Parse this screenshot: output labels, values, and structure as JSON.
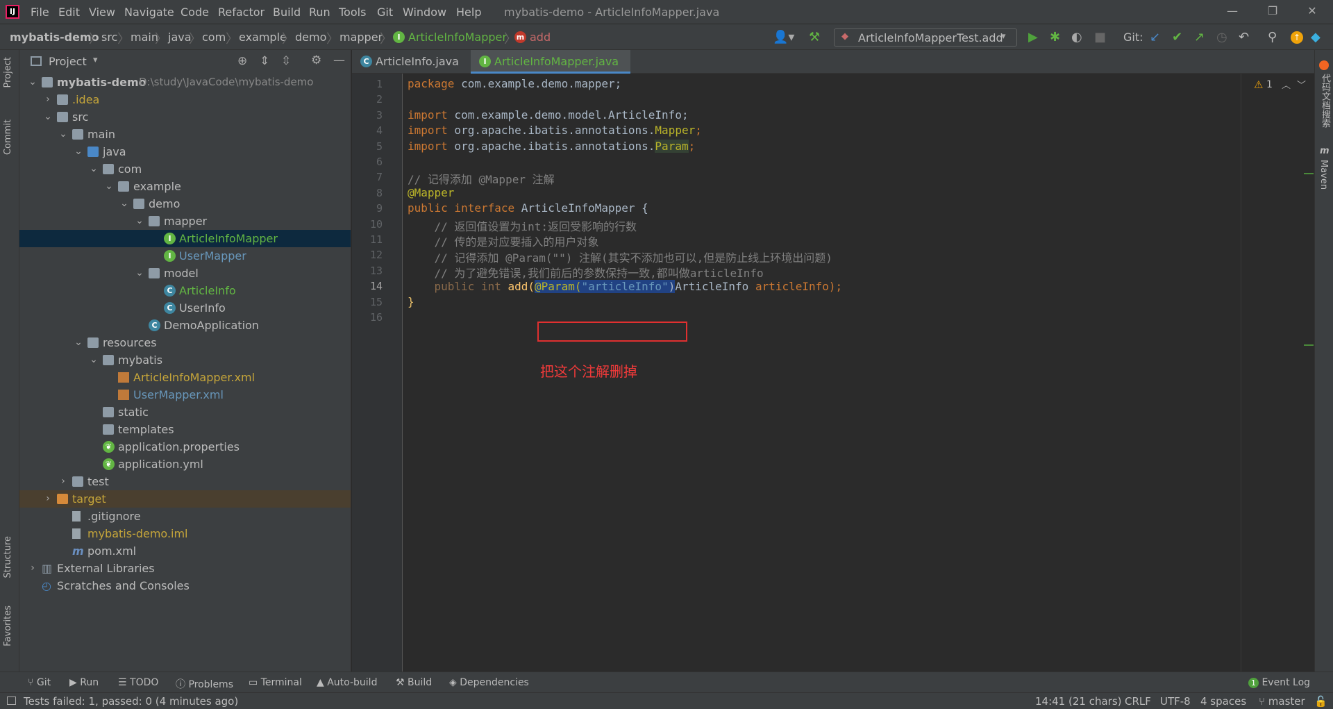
{
  "menu": [
    "File",
    "Edit",
    "View",
    "Navigate",
    "Code",
    "Refactor",
    "Build",
    "Run",
    "Tools",
    "Git",
    "Window",
    "Help"
  ],
  "window_title": "mybatis-demo - ArticleInfoMapper.java",
  "breadcrumbs": [
    "mybatis-demo",
    "src",
    "main",
    "java",
    "com",
    "example",
    "demo",
    "mapper",
    "ArticleInfoMapper",
    "add"
  ],
  "run_config": "ArticleInfoMapperTest.add",
  "git_label": "Git:",
  "project_panel": {
    "title": "Project",
    "tree": [
      {
        "label": "mybatis-demo",
        "extra": "D:\\study\\JavaCode\\mybatis-demo",
        "depth": 0,
        "arrow": "down",
        "icon": "folder",
        "color": "#bbbbbb",
        "bold": true
      },
      {
        "label": ".idea",
        "depth": 1,
        "arrow": "right",
        "icon": "folder",
        "color": "#c5a53a"
      },
      {
        "label": "src",
        "depth": 1,
        "arrow": "down",
        "icon": "folder",
        "color": "#bbbbbb"
      },
      {
        "label": "main",
        "depth": 2,
        "arrow": "down",
        "icon": "folder",
        "color": "#bbbbbb"
      },
      {
        "label": "java",
        "depth": 3,
        "arrow": "down",
        "icon": "folder-blue",
        "color": "#bbbbbb"
      },
      {
        "label": "com",
        "depth": 4,
        "arrow": "down",
        "icon": "package",
        "color": "#bbbbbb"
      },
      {
        "label": "example",
        "depth": 5,
        "arrow": "down",
        "icon": "package",
        "color": "#bbbbbb"
      },
      {
        "label": "demo",
        "depth": 6,
        "arrow": "down",
        "icon": "package",
        "color": "#bbbbbb"
      },
      {
        "label": "mapper",
        "depth": 7,
        "arrow": "down",
        "icon": "package",
        "color": "#bbbbbb"
      },
      {
        "label": "ArticleInfoMapper",
        "depth": 8,
        "icon": "interface",
        "color": "#62b543",
        "selected": true
      },
      {
        "label": "UserMapper",
        "depth": 8,
        "icon": "interface",
        "color": "#6897bb"
      },
      {
        "label": "model",
        "depth": 7,
        "arrow": "down",
        "icon": "package",
        "color": "#bbbbbb"
      },
      {
        "label": "ArticleInfo",
        "depth": 8,
        "icon": "class",
        "color": "#62b543"
      },
      {
        "label": "UserInfo",
        "depth": 8,
        "icon": "class",
        "color": "#bbbbbb"
      },
      {
        "label": "DemoApplication",
        "depth": 7,
        "icon": "class-spring",
        "color": "#bbbbbb"
      },
      {
        "label": "resources",
        "depth": 3,
        "arrow": "down",
        "icon": "folder-res",
        "color": "#bbbbbb"
      },
      {
        "label": "mybatis",
        "depth": 4,
        "arrow": "down",
        "icon": "folder",
        "color": "#bbbbbb"
      },
      {
        "label": "ArticleInfoMapper.xml",
        "depth": 5,
        "icon": "xml",
        "color": "#c5a53a"
      },
      {
        "label": "UserMapper.xml",
        "depth": 5,
        "icon": "xml",
        "color": "#6897bb"
      },
      {
        "label": "static",
        "depth": 4,
        "icon": "folder",
        "color": "#bbbbbb"
      },
      {
        "label": "templates",
        "depth": 4,
        "icon": "folder",
        "color": "#bbbbbb"
      },
      {
        "label": "application.properties",
        "depth": 4,
        "icon": "spring",
        "color": "#bbbbbb"
      },
      {
        "label": "application.yml",
        "depth": 4,
        "icon": "spring",
        "color": "#bbbbbb"
      },
      {
        "label": "test",
        "depth": 2,
        "arrow": "right",
        "icon": "folder",
        "color": "#bbbbbb"
      },
      {
        "label": "target",
        "depth": 1,
        "arrow": "right",
        "icon": "folder-orange",
        "color": "#c5a53a",
        "excluded": true
      },
      {
        "label": ".gitignore",
        "depth": 2,
        "icon": "file",
        "color": "#bbbbbb"
      },
      {
        "label": "mybatis-demo.iml",
        "depth": 2,
        "icon": "file",
        "color": "#c5a53a"
      },
      {
        "label": "pom.xml",
        "depth": 2,
        "icon": "maven",
        "color": "#bbbbbb"
      },
      {
        "label": "External Libraries",
        "depth": 0,
        "arrow": "right",
        "icon": "libs",
        "color": "#bbbbbb"
      },
      {
        "label": "Scratches and Consoles",
        "depth": 0,
        "icon": "scratch",
        "color": "#bbbbbb"
      }
    ]
  },
  "editor_tabs": [
    {
      "label": "ArticleInfo.java",
      "active": false
    },
    {
      "label": "ArticleInfoMapper.java",
      "active": true
    }
  ],
  "line_numbers": [
    "1",
    "2",
    "3",
    "4",
    "5",
    "6",
    "7",
    "8",
    "9",
    "10",
    "11",
    "12",
    "13",
    "14",
    "15",
    "16"
  ],
  "code": {
    "l1_kw": "package",
    "l1_rest": " com.example.demo.mapper;",
    "l3_kw": "import",
    "l3_rest": " com.example.demo.model.ArticleInfo;",
    "l4_kw": "import",
    "l4_rest": " org.apache.ibatis.annotations.",
    "l4_ann": "Mapper",
    "l5_kw": "import",
    "l5_rest": " org.apache.ibatis.annotations.",
    "l5_ann": "Param",
    "l7": "// 记得添加 @Mapper 注解",
    "l8": "@Mapper",
    "l9_kw": "public interface",
    "l9_rest": " ArticleInfoMapper {",
    "l10": "    // 返回值设置为int:返回受影响的行数",
    "l11": "    // 传的是对应要插入的用户对象",
    "l12": "    // 记得添加 @Param(\"\") 注解(其实不添加也可以,但是防止线上环境出问题)",
    "l13": "    // 为了避免错误,我们前后的参数保持一致,都叫做articleInfo",
    "l14_a": "    public int ",
    "l14_b": "add(",
    "l14_ann": "@Param(",
    "l14_str": "\"articleInfo\"",
    "l14_c": ")",
    "l14_d": "ArticleInfo ",
    "l14_e": "articleInfo",
    "l14_f": ");",
    "l15": "}"
  },
  "annotation_note": "把这个注解删掉",
  "warning_count": "1",
  "left_tabs": [
    "Project",
    "Commit",
    "Structure",
    "Favorites"
  ],
  "right_tabs": [
    "代码文档搜索",
    "Maven"
  ],
  "bottom_tools": [
    "Git",
    "Run",
    "TODO",
    "Problems",
    "Terminal",
    "Auto-build",
    "Build",
    "Dependencies"
  ],
  "event_log": "Event Log",
  "status": {
    "message": "Tests failed: 1, passed: 0 (4 minutes ago)",
    "position": "14:41 (21 chars)",
    "line_sep": "CRLF",
    "encoding": "UTF-8",
    "indent": "4 spaces",
    "branch": "master"
  },
  "colors": {
    "accent": "#4a88c7",
    "keyword": "#cc7832",
    "annotation": "#bbb529",
    "comment": "#808080",
    "string": "#6a8759",
    "note_red": "#f03a3a"
  }
}
